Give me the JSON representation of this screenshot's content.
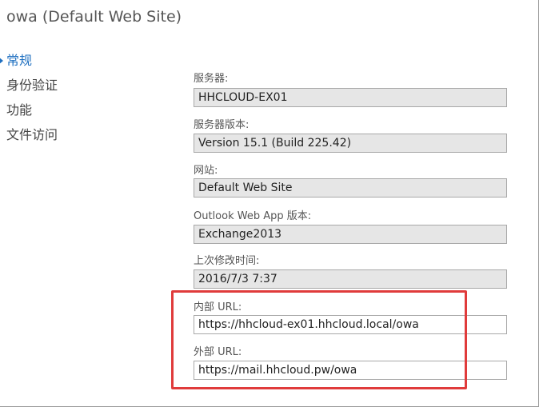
{
  "title": "owa (Default Web Site)",
  "nav": {
    "items": [
      {
        "label": "常规",
        "active": true
      },
      {
        "label": "身份验证",
        "active": false
      },
      {
        "label": "功能",
        "active": false
      },
      {
        "label": "文件访问",
        "active": false
      }
    ]
  },
  "fields": {
    "server": {
      "label": "服务器:",
      "value": "HHCLOUD-EX01"
    },
    "server_version": {
      "label": "服务器版本:",
      "value": "Version 15.1 (Build 225.42)"
    },
    "website": {
      "label": "网站:",
      "value": "Default Web Site"
    },
    "owa_version": {
      "label": "Outlook Web App 版本:",
      "value": "Exchange2013"
    },
    "last_modified": {
      "label": "上次修改时间:",
      "value": "2016/7/3 7:37"
    },
    "internal_url": {
      "label": "内部 URL:",
      "value": "https://hhcloud-ex01.hhcloud.local/owa"
    },
    "external_url": {
      "label": "外部 URL:",
      "value": "https://mail.hhcloud.pw/owa"
    }
  },
  "colors": {
    "accent": "#1e6fc0",
    "highlight": "#e03b3b"
  }
}
